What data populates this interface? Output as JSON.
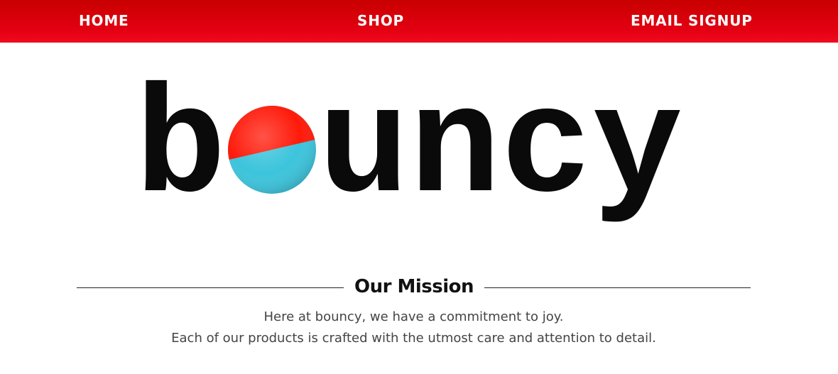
{
  "nav": {
    "home_label": "HOME",
    "shop_label": "SHOP",
    "email_signup_label": "EMAIL SIGNUP"
  },
  "logo": {
    "prefix": "b",
    "suffix": "uncy",
    "ball_icon": "bouncy-ball-icon"
  },
  "mission": {
    "title": "Our Mission",
    "line1": "Here at bouncy, we have a commitment to joy.",
    "line2": "Each of our products is crafted with the utmost care and attention to detail."
  },
  "colors": {
    "nav_red": "#e30012",
    "ball_red": "#ff1a0a",
    "ball_blue": "#3cc4dc"
  }
}
